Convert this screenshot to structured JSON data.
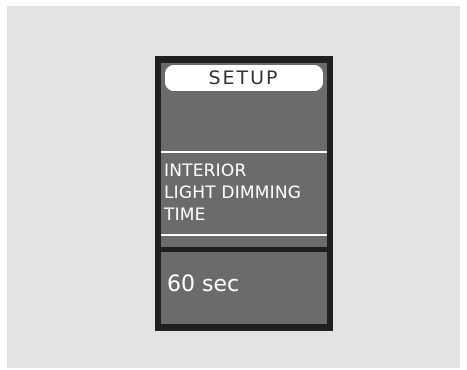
{
  "display": {
    "header": "SETUP",
    "setting_title_lines": [
      "INTERIOR",
      "LIGHT DIMMING",
      "TIME"
    ],
    "setting_value": "60 sec"
  },
  "colors": {
    "background": "#e3e3e5",
    "bezel": "#231f20",
    "screen": "#6b6b6b",
    "text": "#ffffff"
  }
}
